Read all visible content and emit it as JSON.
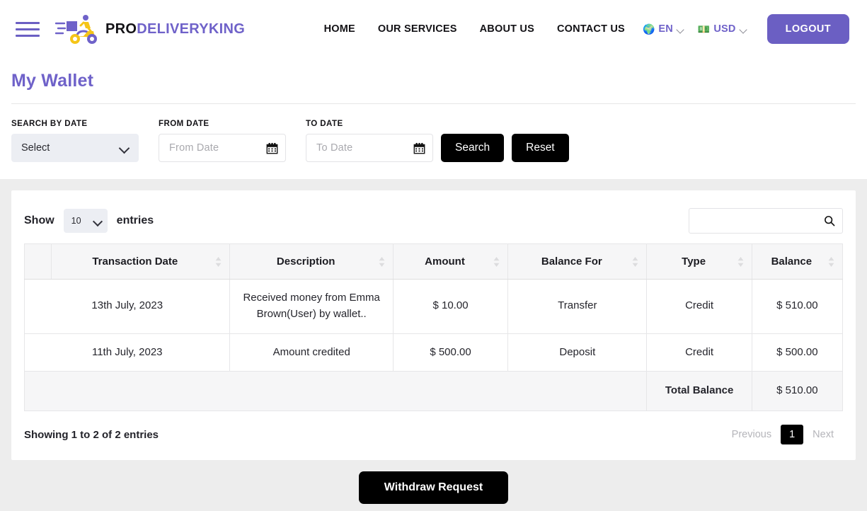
{
  "header": {
    "menu_icon": "hamburger-menu-icon",
    "brand": {
      "logo_icon": "scooter-delivery-icon",
      "name_primary": "PRO",
      "name_secondary": "DELIVERYKING"
    },
    "nav": [
      {
        "label": "HOME"
      },
      {
        "label": "OUR SERVICES"
      },
      {
        "label": "ABOUT US"
      },
      {
        "label": "CONTACT US"
      }
    ],
    "language": {
      "icon": "globe-icon",
      "glyph": "🌍",
      "code": "EN"
    },
    "currency": {
      "icon": "money-icon",
      "glyph": "💵",
      "code": "USD"
    },
    "logout_label": "LOGOUT",
    "accent_color": "#6b5fc3"
  },
  "page": {
    "title": "My Wallet",
    "title_color": "#6f62c9"
  },
  "filters": {
    "search_by_date": {
      "label": "SEARCH BY DATE",
      "selected": "Select"
    },
    "from_date": {
      "label": "FROM DATE",
      "placeholder": "From Date",
      "value": "",
      "icon": "calendar-icon"
    },
    "to_date": {
      "label": "TO DATE",
      "placeholder": "To Date",
      "value": "",
      "icon": "calendar-icon"
    },
    "search_button": "Search",
    "reset_button": "Reset"
  },
  "table_controls": {
    "show_label": "Show",
    "entries_label": "entries",
    "page_length": "10",
    "search_placeholder": "",
    "search_value": "",
    "search_icon": "search-icon"
  },
  "table": {
    "columns": [
      "Transaction Date",
      "Description",
      "Amount",
      "Balance For",
      "Type",
      "Balance"
    ],
    "rows": [
      {
        "date": "13th July, 2023",
        "description": "Received money from Emma Brown(User) by wallet..",
        "amount": "$ 10.00",
        "balance_for": "Transfer",
        "type": "Credit",
        "balance": "$ 510.00"
      },
      {
        "date": "11th July, 2023",
        "description": "Amount credited",
        "amount": "$ 500.00",
        "balance_for": "Deposit",
        "type": "Credit",
        "balance": "$ 500.00"
      }
    ],
    "total_label": "Total Balance",
    "total_value": "$ 510.00"
  },
  "footer": {
    "info": "Showing 1 to 2 of 2 entries",
    "previous_label": "Previous",
    "current_page": "1",
    "next_label": "Next"
  },
  "actions": {
    "withdraw_label": "Withdraw Request"
  }
}
